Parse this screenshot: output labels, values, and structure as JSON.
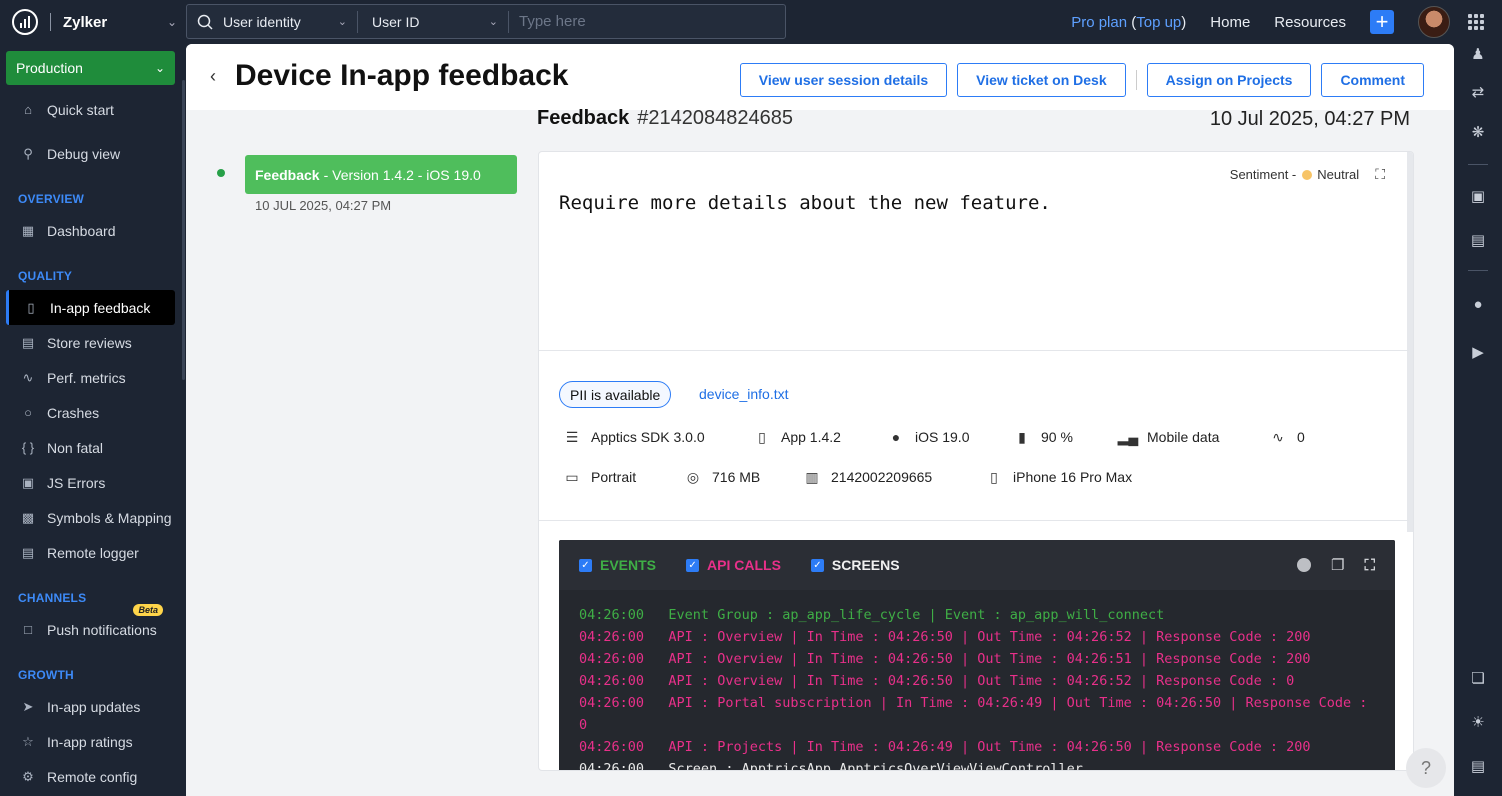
{
  "brand": {
    "name": "Zylker"
  },
  "search": {
    "scope": "User identity",
    "field": "User ID",
    "placeholder": "Type here"
  },
  "topnav": {
    "plan": "Pro plan",
    "topup_open": "(",
    "topup": "Top up",
    "topup_close": ")",
    "home": "Home",
    "resources": "Resources",
    "plus": "+"
  },
  "sidebar": {
    "environment": "Production",
    "items_top": [
      {
        "label": "Quick start",
        "icon": "home-icon"
      },
      {
        "label": "Debug view",
        "icon": "pin-icon"
      }
    ],
    "overview_label": "OVERVIEW",
    "overview": [
      {
        "label": "Dashboard",
        "icon": "dashboard-icon"
      }
    ],
    "quality_label": "QUALITY",
    "quality": [
      {
        "label": "In-app feedback",
        "icon": "feedback-icon",
        "active": true
      },
      {
        "label": "Store reviews",
        "icon": "reviews-icon"
      },
      {
        "label": "Perf. metrics",
        "icon": "metrics-icon"
      },
      {
        "label": "Crashes",
        "icon": "crash-icon"
      },
      {
        "label": "Non fatal",
        "icon": "braces-icon"
      },
      {
        "label": "JS Errors",
        "icon": "js-icon"
      },
      {
        "label": "Symbols & Mapping",
        "icon": "symbols-icon"
      },
      {
        "label": "Remote logger",
        "icon": "logger-icon"
      }
    ],
    "channels_label": "CHANNELS",
    "channels": [
      {
        "label": "Push notifications",
        "icon": "push-icon",
        "badge": "Beta"
      }
    ],
    "growth_label": "GROWTH",
    "growth": [
      {
        "label": "In-app updates",
        "icon": "rocket-icon"
      },
      {
        "label": "In-app ratings",
        "icon": "star-icon"
      },
      {
        "label": "Remote config",
        "icon": "config-icon"
      }
    ]
  },
  "page": {
    "title": "Device In-app feedback",
    "buttons": {
      "session": "View user session details",
      "ticket": "View ticket on Desk",
      "projects": "Assign on Projects",
      "comment": "Comment"
    },
    "feedback_label": "Feedback",
    "feedback_id": "#2142084824685",
    "feedback_date": "10 Jul 2025, 04:27 PM",
    "version_chip_bold": "Feedback",
    "version_chip_rest": "- Version 1.4.2 - iOS 19.0",
    "version_date": "10 JUL 2025, 04:27 PM"
  },
  "card": {
    "sentiment_label": "Sentiment -",
    "sentiment_value": "Neutral",
    "feedback_text": "Require more details about the new feature.",
    "pii": "PII is available",
    "attachment": "device_info.txt",
    "info_row1": [
      {
        "icon": "layers-icon",
        "value": "Apptics SDK 3.0.0"
      },
      {
        "icon": "app-version-icon",
        "value": "App 1.4.2"
      },
      {
        "icon": "apple-icon",
        "value": "iOS 19.0"
      },
      {
        "icon": "battery-icon",
        "value": "90 %"
      },
      {
        "icon": "signal-icon",
        "value": "Mobile data"
      },
      {
        "icon": "wifi-icon",
        "value": "0"
      }
    ],
    "info_row2": [
      {
        "icon": "orientation-icon",
        "value": "Portrait"
      },
      {
        "icon": "storage-icon",
        "value": "716 MB"
      },
      {
        "icon": "device-id-icon",
        "value": "2142002209665"
      },
      {
        "icon": "phone-icon",
        "value": "iPhone 16 Pro Max"
      }
    ]
  },
  "console": {
    "tabs": {
      "events": "EVENTS",
      "api": "API CALLS",
      "screens": "SCREENS"
    },
    "colors": {
      "event": "#3fae46",
      "api": "#e8308a",
      "screen": "#e8e8e8"
    },
    "logs": [
      {
        "type": "event",
        "time": "04:26:00",
        "text": "Event Group : ap_app_life_cycle | Event : ap_app_will_connect"
      },
      {
        "type": "api",
        "time": "04:26:00",
        "text": "API : Overview | In Time : 04:26:50 | Out Time : 04:26:52 | Response Code : 200"
      },
      {
        "type": "api",
        "time": "04:26:00",
        "text": "API : Overview | In Time : 04:26:50 | Out Time : 04:26:51 | Response Code : 200"
      },
      {
        "type": "api",
        "time": "04:26:00",
        "text": "API : Overview | In Time : 04:26:50 | Out Time : 04:26:52 | Response Code : 0"
      },
      {
        "type": "api",
        "time": "04:26:00",
        "text": "API : Portal subscription | In Time : 04:26:49 | Out Time : 04:26:50 | Response Code : 0"
      },
      {
        "type": "api",
        "time": "04:26:00",
        "text": "API : Projects | In Time : 04:26:49 | Out Time : 04:26:50 | Response Code : 200"
      },
      {
        "type": "screen",
        "time": "04:26:00",
        "text": "Screen : ApptricsApp.ApptricsOverViewViewController"
      }
    ]
  },
  "help": "?"
}
